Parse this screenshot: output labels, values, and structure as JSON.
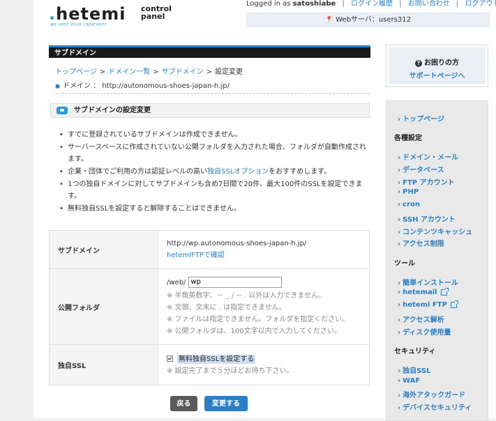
{
  "header": {
    "logo_text": "hetemi",
    "logo_tagline": "WE HOST YOUR CREATIVITY",
    "logo_sub1": "control",
    "logo_sub2": "panel",
    "logged_in_prefix": "Logged in as",
    "username": "satoshiabe",
    "links": [
      "ログイン履歴",
      "お問い合わせ",
      "ログアウト"
    ],
    "server_label": "Webサーバ：users312"
  },
  "main": {
    "section_title": "サブドメイン",
    "breadcrumb": [
      "トップページ",
      "ドメイン一覧",
      "サブドメイン",
      "設定変更"
    ],
    "domain_line": "ドメイン ： http://autonomous-shoes-japan-h.jp/",
    "subheading": "サブドメインの設定変更",
    "notes": {
      "n1": "すでに登録されているサブドメインは作成できません。",
      "n2": "サーバースペースに作成されていない公開フォルダを入力された場合、フォルダが自動作成されます。",
      "n3_pre": "企業・団体でご利用の方は認証レベルの高い",
      "n3_link": "独自SSLオプション",
      "n3_post": "をおすすめします。",
      "n4": "1つの独自ドメインに対してサブドメインも含め7日間で20件、最大100件のSSLを設定できます。",
      "n5": "無料独自SSLを設定すると解除することはできません。"
    },
    "form": {
      "subdomain_label": "サブドメイン",
      "subdomain_value": "http://wp.autonomous-shoes-japan-h.jp/",
      "subdomain_link": "hetemlFTPで確認",
      "folder_label": "公開フォルダ",
      "folder_prefix": "/web/",
      "folder_value": "wp",
      "folder_notes": [
        "※ 半角英数字、－ _ / ~ . 以外は入力できません。",
        "※ 文頭、文末に . は指定できません。",
        "※ ファイルは指定できません。フォルダを指定ください。",
        "※ 公開フォルダは、100文字以内で入力してください。"
      ],
      "ssl_label": "独自SSL",
      "ssl_checkbox_label": "無料独自SSLを設定する",
      "ssl_checked": true,
      "ssl_note": "※ 設定完了まで５分ほどお待ち下さい。"
    },
    "buttons": {
      "back": "戻る",
      "submit": "変更する"
    }
  },
  "sidebar": {
    "help_title": "お困りの方",
    "help_link": "サポートページへ",
    "top_link": "トップページ",
    "sections": [
      {
        "heading": "各種設定",
        "items": [
          "ドメイン・メール",
          "データベース",
          "FTP アカウント",
          "PHP",
          "cron",
          "SSH アカウント",
          "コンテンツキャッシュ",
          "アクセス制限"
        ]
      },
      {
        "heading": "ツール",
        "items": [
          "簡単インストール",
          "hetemail",
          "heteml FTP",
          "アクセス解析",
          "ディスク使用量"
        ]
      },
      {
        "heading": "セキュリティ",
        "items": [
          "独自SSL",
          "WAF",
          "海外アタックガード",
          "デバイスセキュリティ"
        ]
      }
    ]
  },
  "colors": {
    "accent": "#2a7fc9",
    "title_bar": "#1a1a1a",
    "sidebar_bg": "#e9e9e9"
  }
}
